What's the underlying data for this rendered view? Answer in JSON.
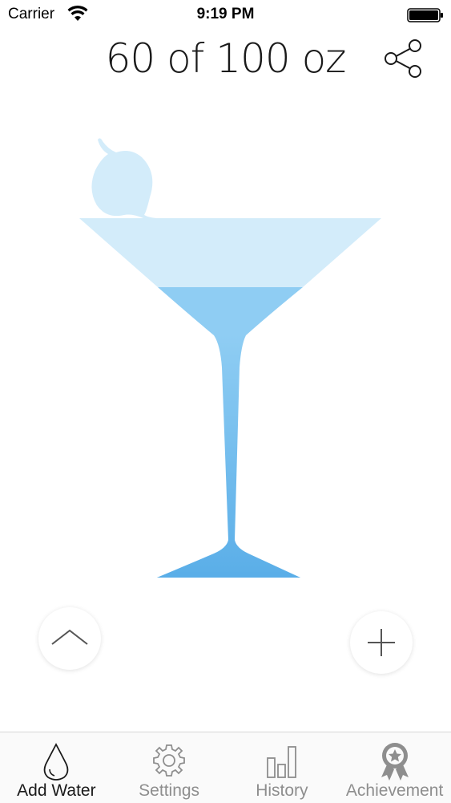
{
  "status_bar": {
    "carrier": "Carrier",
    "time": "9:19 PM"
  },
  "header": {
    "current": "60",
    "separator": "of",
    "goal": "100",
    "unit": "oz"
  },
  "progress": {
    "fraction": 0.6
  },
  "colors": {
    "water_light": "#d3ecfa",
    "water_dark": "#6ab8ec",
    "water_mid": "#8fcdf3",
    "tab_active": "#1a1a1a",
    "tab_inactive": "#8e8e8e"
  },
  "icons": {
    "share": "share-icon",
    "up": "chevron-up-icon",
    "add": "plus-icon"
  },
  "tabs": [
    {
      "label": "Add Water",
      "icon": "water-drop-icon",
      "active": true
    },
    {
      "label": "Settings",
      "icon": "gear-icon",
      "active": false
    },
    {
      "label": "History",
      "icon": "bar-chart-icon",
      "active": false
    },
    {
      "label": "Achievement",
      "icon": "award-ribbon-icon",
      "active": false
    }
  ]
}
